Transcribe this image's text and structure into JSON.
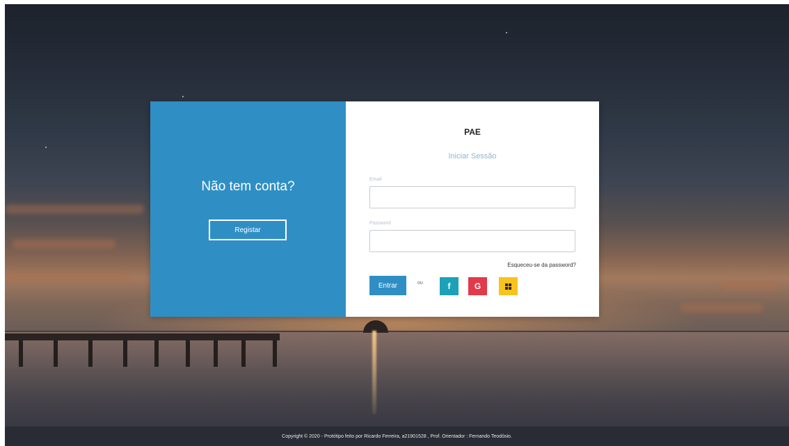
{
  "left_panel": {
    "title": "Não tem conta?",
    "register_label": "Registar"
  },
  "right_panel": {
    "brand": "PAE",
    "subtitle": "Iniciar Sessão",
    "email_label": "Email",
    "email_value": "",
    "password_label": "Password",
    "password_value": "",
    "forgot_label": "Esqueceu-se da password?",
    "enter_label": "Entrar",
    "or_label": "ou",
    "social": {
      "facebook": "f",
      "google": "G"
    }
  },
  "footer": {
    "text": "Copyright © 2020 - Protótipo feito por Ricardo Ferreira, a21901528 , Prof. Orientador : Fernando Teodósio."
  },
  "colors": {
    "primary": "#2f8fc5",
    "facebook": "#1da1b8",
    "google": "#e23a4b",
    "microsoft": "#f7c31c"
  }
}
